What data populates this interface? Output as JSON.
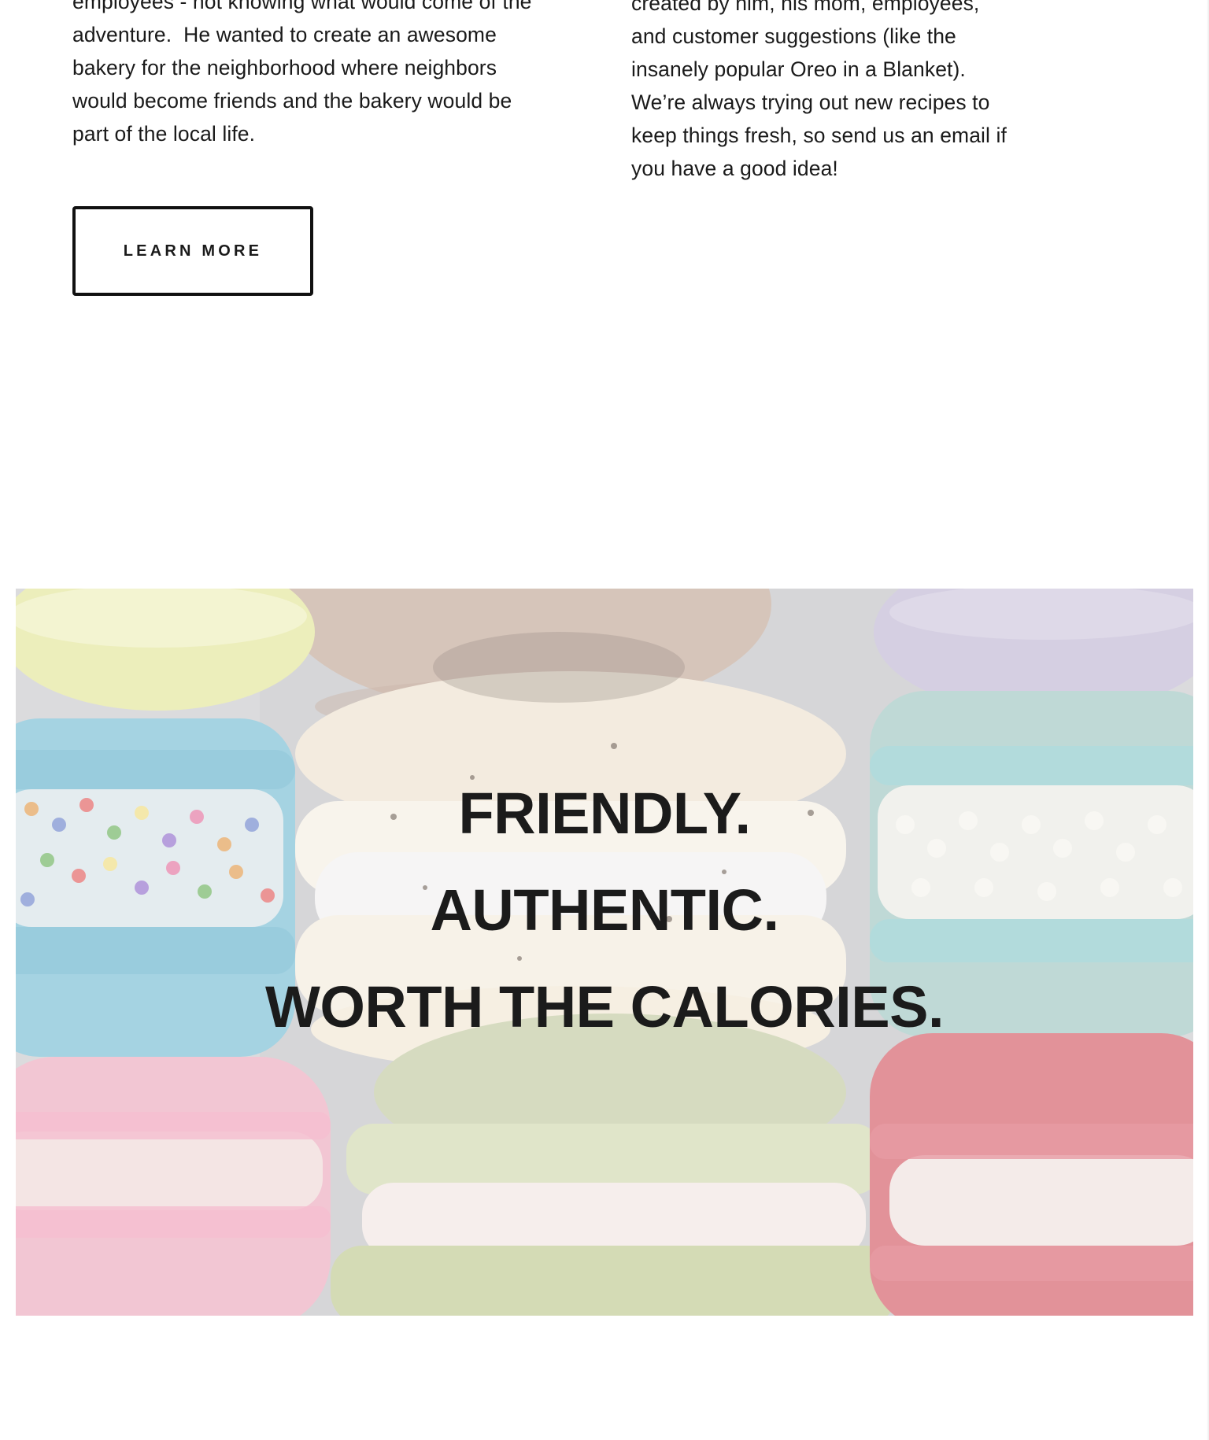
{
  "about": {
    "left_paragraph": [
      "employees - not knowing what would come of the",
      "adventure.  He wanted to create an awesome",
      "bakery for the neighborhood where neighbors",
      "would become friends and the bakery would be",
      "part of the local life."
    ],
    "right_paragraph": [
      "created by him, his mom, employees,",
      "and customer suggestions (like the",
      "insanely popular Oreo in a Blanket).",
      "We’re always trying out new recipes to",
      "keep things fresh, so send us an email if",
      "you have a good idea!"
    ],
    "learn_more_label": "LEARN MORE"
  },
  "banner": {
    "taglines": [
      "FRIENDLY.",
      "AUTHENTIC.",
      "WORTH THE CALORIES."
    ],
    "image_subject": "macarons",
    "colors": {
      "background_wash": "#cfcfcf",
      "yellow": "#e6e8a4",
      "blue": "#86c4d8",
      "cream": "#efe5d4",
      "teal": "#a9ccc8",
      "pink": "#eeb2c4",
      "green": "#c8cfaa",
      "red": "#d86d76",
      "lavender": "#c7bfd8",
      "brown": "#c8b1a2"
    }
  }
}
